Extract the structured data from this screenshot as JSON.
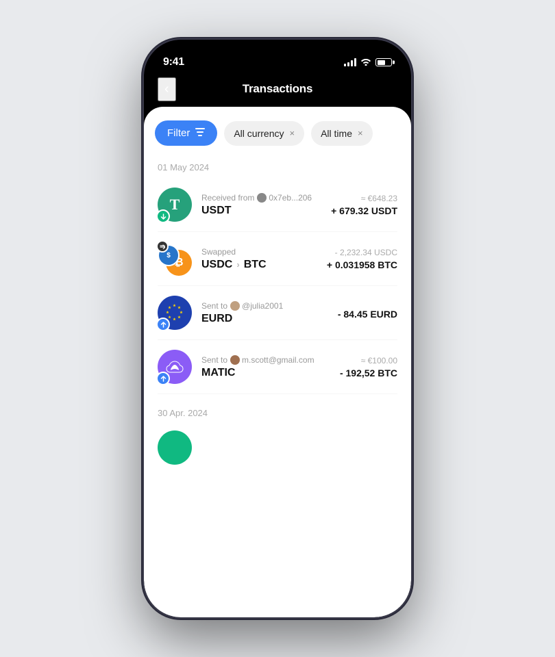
{
  "status_bar": {
    "time": "9:41",
    "signal_label": "signal",
    "wifi_label": "wifi",
    "battery_label": "battery"
  },
  "header": {
    "back_label": "‹",
    "title": "Transactions"
  },
  "filters": {
    "filter_btn_label": "Filter",
    "chip1_label": "All currency",
    "chip1_close": "×",
    "chip2_label": "All time",
    "chip2_close": "×"
  },
  "sections": [
    {
      "date": "01 May 2024",
      "transactions": [
        {
          "id": "tx1",
          "type": "receive",
          "currency": "USDT",
          "subtitle": "Received from",
          "subtitle_addr": "0x7eb...206",
          "title": "USDT",
          "fiat": "≈ €648.23",
          "crypto": "+ 679.32 USDT",
          "crypto_positive": true,
          "icon_color": "#26A17B",
          "icon_text": "T",
          "badge_dir": "down"
        },
        {
          "id": "tx2",
          "type": "swap",
          "currency": "USDC→BTC",
          "subtitle": "Swapped",
          "subtitle_addr": "",
          "title_from": "USDC",
          "title_to": "BTC",
          "fiat": "- 2,232.34 USDC",
          "crypto": "+ 0.031958 BTC",
          "crypto_positive": true
        },
        {
          "id": "tx3",
          "type": "send",
          "currency": "EURD",
          "subtitle": "Sent to",
          "subtitle_addr": "@julia2001",
          "title": "EURD",
          "fiat": "",
          "crypto": "- 84.45 EURD",
          "crypto_positive": false,
          "icon_color": "#1E40AF",
          "icon_text": "★",
          "badge_dir": "up"
        },
        {
          "id": "tx4",
          "type": "send",
          "currency": "MATIC",
          "subtitle": "Sent to",
          "subtitle_addr": "m.scott@gmail.com",
          "title": "MATIC",
          "fiat": "≈ €100.00",
          "crypto": "- 192,52 BTC",
          "crypto_positive": false,
          "icon_color": "#8B5CF6",
          "icon_text": "∞",
          "badge_dir": "up"
        }
      ]
    },
    {
      "date": "30 Apr. 2024",
      "transactions": []
    }
  ]
}
